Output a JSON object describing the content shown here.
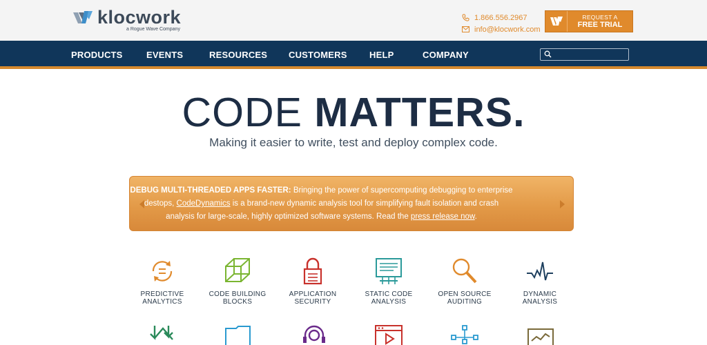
{
  "header": {
    "logo": {
      "wordmark": "klocwork",
      "tagline": "a Rogue Wave Company"
    },
    "phone": "1.866.556.2967",
    "email": "info@klocwork.com",
    "trial_button": {
      "line1": "REQUEST A",
      "line2": "FREE TRIAL"
    }
  },
  "nav": {
    "items": [
      {
        "label": "PRODUCTS"
      },
      {
        "label": "EVENTS"
      },
      {
        "label": "RESOURCES"
      },
      {
        "label": "CUSTOMERS"
      },
      {
        "label": "HELP"
      },
      {
        "label": "COMPANY"
      }
    ],
    "search": {
      "value": "",
      "placeholder": ""
    }
  },
  "hero": {
    "headline_light": "CODE",
    "headline_bold": "MATTERS.",
    "tagline": "Making it easier to write, test and deploy complex code."
  },
  "banner": {
    "lead": "DEBUG MULTI-THREADED APPS FASTER:",
    "text1": " Bringing the power of supercomputing debugging to enterprise des",
    "text2": "tops, ",
    "link1": "CodeDynamics",
    "text3": " is a brand-new dynamic analysis tool for simplifying fault isolation and crash analysis for large-scale, highly optimized software systems. Read the ",
    "link2": "press release now",
    "text4": "."
  },
  "features": [
    {
      "line1": "PREDICTIVE",
      "line2": "ANALYTICS",
      "icon": "predictive-analytics-icon",
      "color": "#e08a2c"
    },
    {
      "line1": "CODE BUILDING",
      "line2": "BLOCKS",
      "icon": "code-building-blocks-icon",
      "color": "#7ab530"
    },
    {
      "line1": "APPLICATION",
      "line2": "SECURITY",
      "icon": "application-security-icon",
      "color": "#c8312b"
    },
    {
      "line1": "STATIC CODE",
      "line2": "ANALYSIS",
      "icon": "static-code-analysis-icon",
      "color": "#2a9a9a"
    },
    {
      "line1": "OPEN SOURCE",
      "line2": "AUDITING",
      "icon": "open-source-auditing-icon",
      "color": "#e08a2c"
    },
    {
      "line1": "DYNAMIC",
      "line2": "ANALYSIS",
      "icon": "dynamic-analysis-icon",
      "color": "#1d3f5e"
    }
  ],
  "colors": {
    "nav": "#10365a",
    "accent": "#e08a2c",
    "headline": "#1d2d44"
  }
}
